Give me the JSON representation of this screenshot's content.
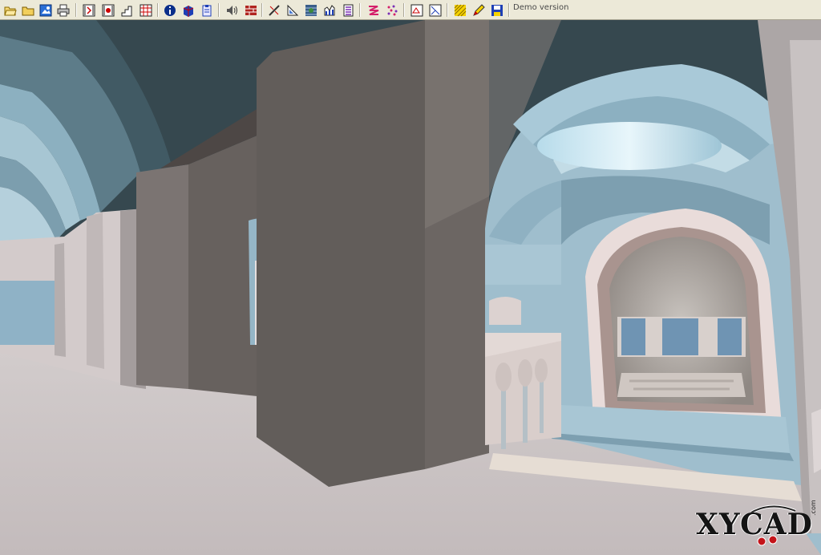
{
  "toolbar": {
    "status_text": "Demo version",
    "buttons": [
      {
        "name": "open-file-button",
        "icon": "open-file-icon"
      },
      {
        "name": "open-folder-button",
        "icon": "folder-icon"
      },
      {
        "name": "image-export-button",
        "icon": "image-icon"
      },
      {
        "name": "print-button",
        "icon": "printer-icon"
      },
      {
        "name": "film-button",
        "icon": "film-icon"
      },
      {
        "name": "film-record-button",
        "icon": "film-record-icon"
      },
      {
        "name": "stairs-button",
        "icon": "stairs-icon"
      },
      {
        "name": "grid-button",
        "icon": "grid-icon"
      },
      {
        "name": "info-button",
        "icon": "info-icon"
      },
      {
        "name": "solid-button",
        "icon": "solid-icon"
      },
      {
        "name": "clipboard-button",
        "icon": "clipboard-icon"
      },
      {
        "name": "sound-button",
        "icon": "speaker-icon"
      },
      {
        "name": "wall-button",
        "icon": "brick-wall-icon"
      },
      {
        "name": "measure-button",
        "icon": "measure-icon"
      },
      {
        "name": "triangle-button",
        "icon": "triangle-icon"
      },
      {
        "name": "texture-button",
        "icon": "texture-icon"
      },
      {
        "name": "chart-button",
        "icon": "chart-icon"
      },
      {
        "name": "layers-button",
        "icon": "layers-icon"
      },
      {
        "name": "zigzag-button",
        "icon": "zigzag-icon"
      },
      {
        "name": "scatter-button",
        "icon": "scatter-icon"
      },
      {
        "name": "frame-button",
        "icon": "frame-icon"
      },
      {
        "name": "perspective-button",
        "icon": "perspective-icon"
      },
      {
        "name": "hatch-button",
        "icon": "hatch-icon"
      },
      {
        "name": "pencil-button",
        "icon": "pencil-icon"
      },
      {
        "name": "save-button",
        "icon": "save-icon"
      }
    ]
  },
  "watermark": {
    "logo_text": "XYCAD",
    "suffix": ".com"
  },
  "colors": {
    "toolbar_bg": "#ece9d8",
    "pillar": "#625d5a",
    "vault_blue": "#a9c9d8",
    "floor": "#c9c2c2",
    "watermark_red": "#c4141a"
  }
}
